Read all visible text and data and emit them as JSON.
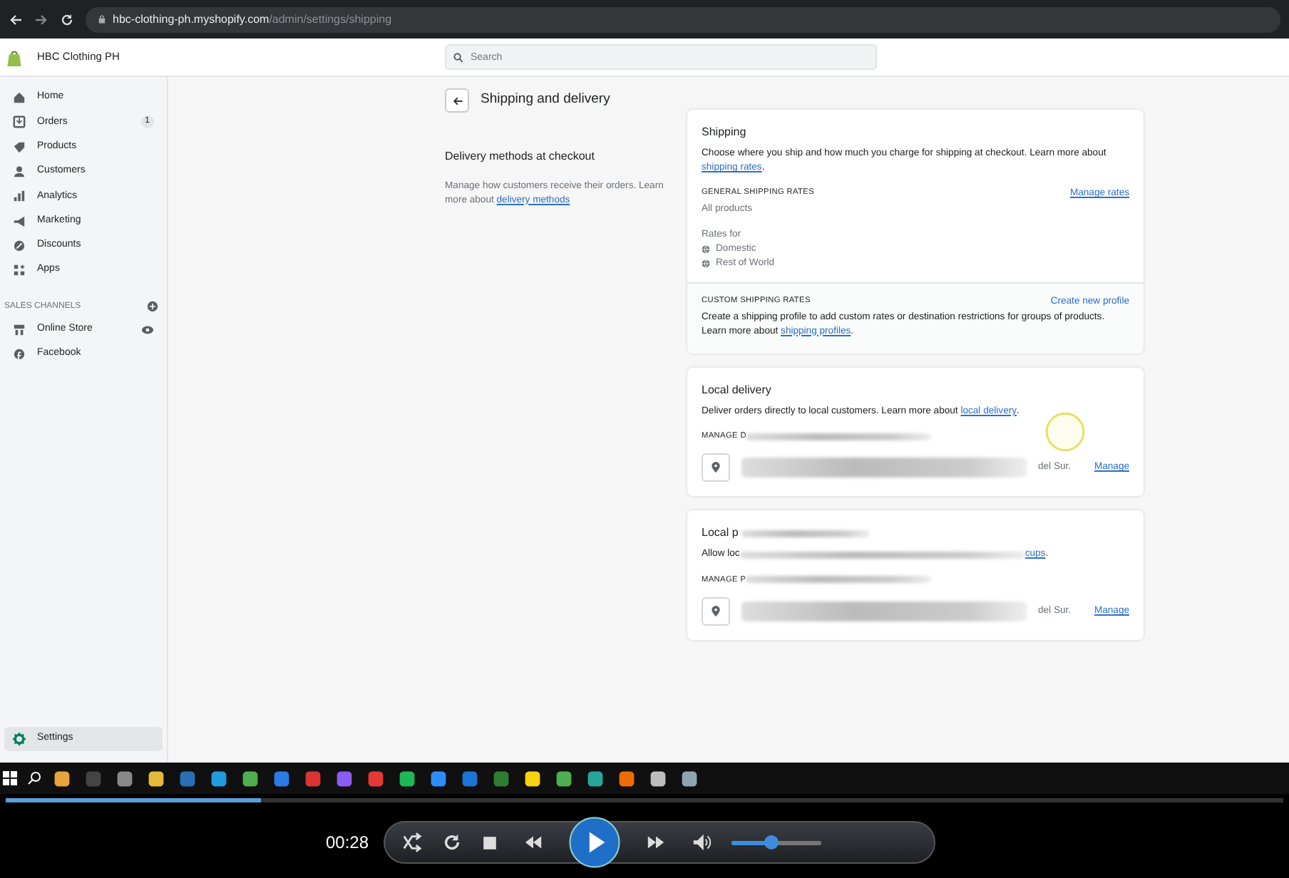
{
  "browser": {
    "url_host": "hbc-clothing-ph.myshopify.com",
    "url_path": "/admin/settings/shipping"
  },
  "topbar": {
    "store_name": "HBC Clothing PH",
    "search_placeholder": "Search"
  },
  "sidebar": {
    "items": [
      {
        "label": "Home",
        "kind": "home",
        "selected": false
      },
      {
        "label": "Orders",
        "kind": "orders",
        "badge": "1",
        "selected": false
      },
      {
        "label": "Products",
        "kind": "tag",
        "selected": false
      },
      {
        "label": "Customers",
        "kind": "person",
        "selected": false
      },
      {
        "label": "Analytics",
        "kind": "bars",
        "selected": false
      },
      {
        "label": "Marketing",
        "kind": "megaphone",
        "selected": false
      },
      {
        "label": "Discounts",
        "kind": "discount",
        "selected": false
      },
      {
        "label": "Apps",
        "kind": "apps",
        "selected": false
      }
    ],
    "channels_heading": "SALES CHANNELS",
    "channels": [
      {
        "label": "Online Store",
        "kind": "store",
        "selected": false
      },
      {
        "label": "Facebook",
        "kind": "facebook",
        "selected": false
      }
    ],
    "settings": {
      "label": "Settings",
      "selected": true
    }
  },
  "page": {
    "title": "Shipping and delivery",
    "section_title": "Delivery methods at checkout",
    "section_desc": "Manage how customers receive their orders. Learn more about ",
    "section_link": "delivery methods"
  },
  "shipping": {
    "title": "Shipping",
    "desc": "Choose where you ship and how much you charge for shipping at checkout. Learn more about ",
    "link": "shipping rates",
    "after": ".",
    "general_heading": "GENERAL SHIPPING RATES",
    "general_sub": "All products",
    "manage_link": "Manage rates",
    "rates_label": "Rates for",
    "zones": [
      "Domestic",
      "Rest of World"
    ],
    "custom_heading": "CUSTOM SHIPPING RATES",
    "custom_action": "Create new profile",
    "custom_desc": "Create a shipping profile to add custom rates or destination restrictions for groups of products. Learn more about ",
    "custom_link": "shipping profiles",
    "custom_after": "."
  },
  "methods": [
    {
      "title": "Local delivery",
      "desc": "Deliver orders directly to local customers. Learn more about ",
      "link": "local delivery",
      "after": ".",
      "heading": "MANAGE D",
      "location_suffix": "del Sur.",
      "manage": "Manage"
    },
    {
      "title": "Local p",
      "desc": "Allow loc",
      "link": "cups",
      "after": ".",
      "heading": "MANAGE P",
      "location_suffix": "del Sur.",
      "manage": "Manage"
    }
  ],
  "player": {
    "time": "00:28",
    "seek": {
      "level": 0.2
    },
    "volume": {
      "level": 0.45
    }
  }
}
